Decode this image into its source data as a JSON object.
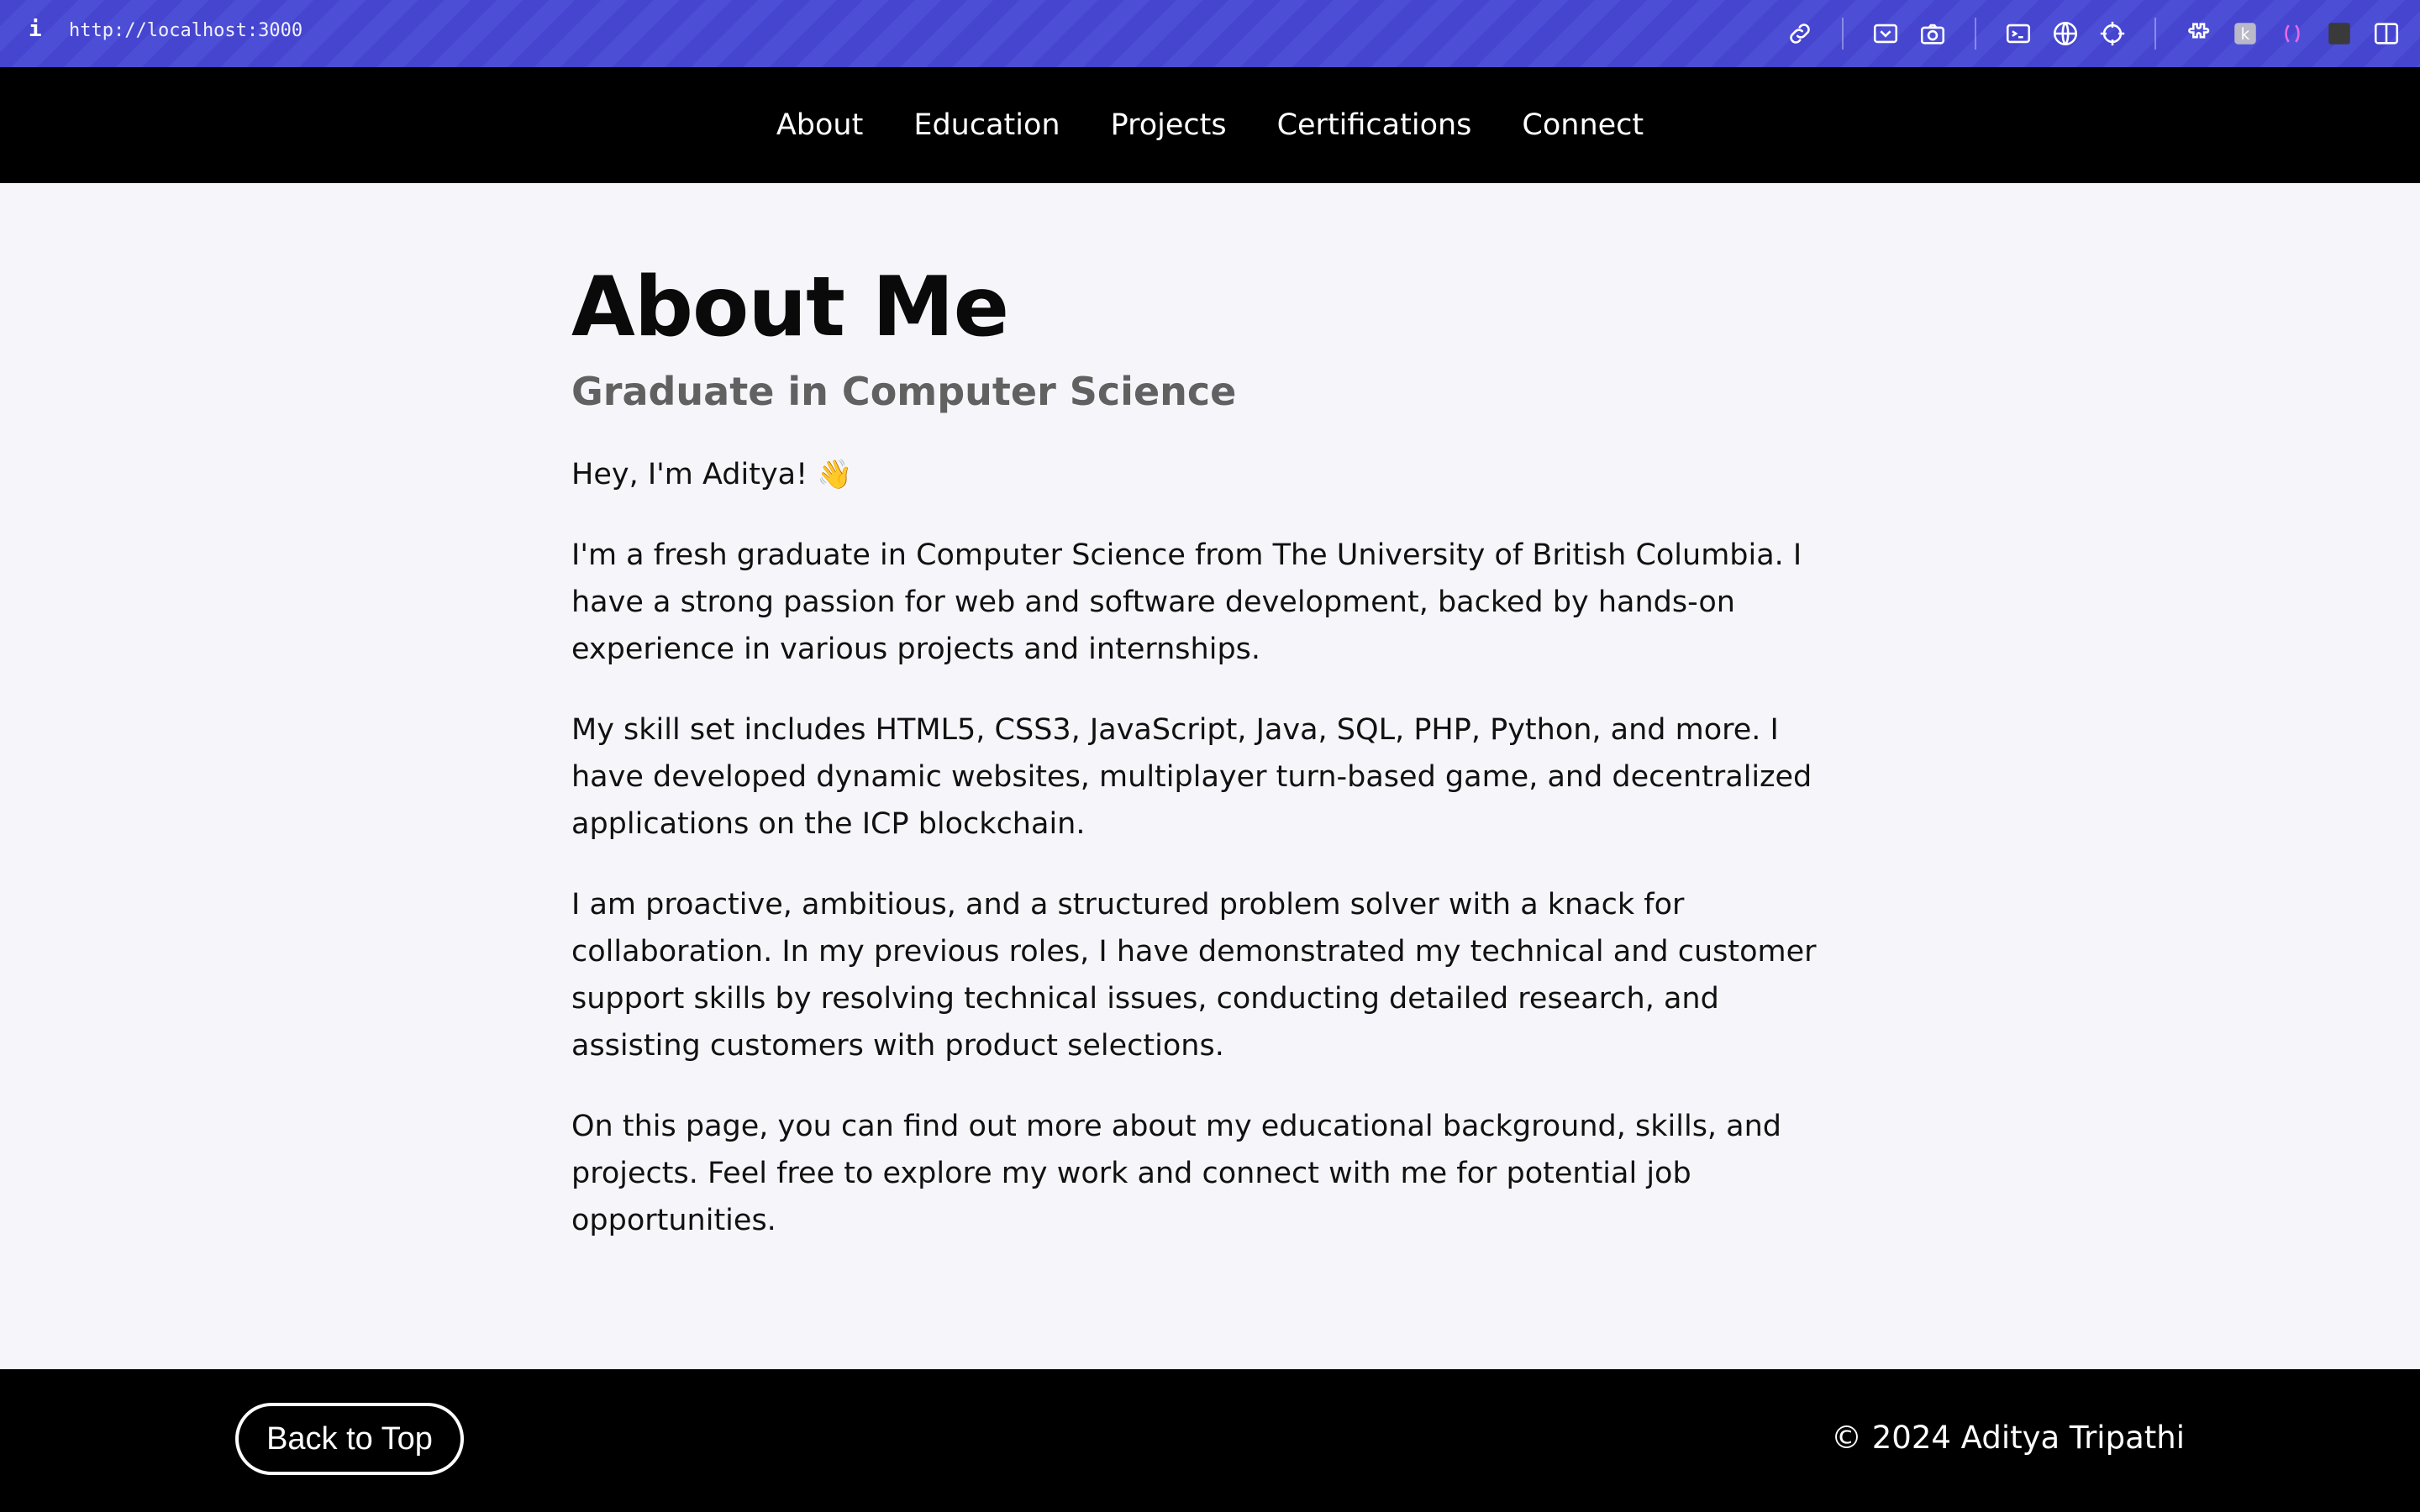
{
  "browser": {
    "info_glyph": "i",
    "url": "http://localhost:3000",
    "toolbar_icons": [
      "link-icon",
      "screenshot-region-icon",
      "camera-icon",
      "terminal-icon",
      "globe-icon",
      "crosshair-icon",
      "extensions-icon",
      "extension-k-icon",
      "parentheses-icon",
      "dark-square-icon",
      "split-view-icon"
    ]
  },
  "nav": {
    "items": [
      {
        "label": "About"
      },
      {
        "label": "Education"
      },
      {
        "label": "Projects"
      },
      {
        "label": "Certifications"
      },
      {
        "label": "Connect"
      }
    ]
  },
  "about": {
    "title": "About Me",
    "subtitle": "Graduate in Computer Science",
    "greeting": "Hey, I'm Aditya!",
    "greeting_emoji": "👋",
    "paragraphs": [
      "I'm a fresh graduate in Computer Science from The University of British Columbia. I have a strong passion for web and software development, backed by hands-on experience in various projects and internships.",
      "My skill set includes HTML5, CSS3, JavaScript, Java, SQL, PHP, Python, and more. I have developed dynamic websites, multiplayer turn-based game, and decentralized applications on the ICP blockchain.",
      "I am proactive, ambitious, and a structured problem solver with a knack for collaboration. In my previous roles, I have demonstrated my technical and customer support skills by resolving technical issues, conducting detailed research, and assisting customers with product selections.",
      "On this page, you can find out more about my educational background, skills, and projects. Feel free to explore my work and connect with me for potential job opportunities."
    ]
  },
  "footer": {
    "back_to_top": "Back to Top",
    "copyright": "© 2024 Aditya Tripathi"
  }
}
